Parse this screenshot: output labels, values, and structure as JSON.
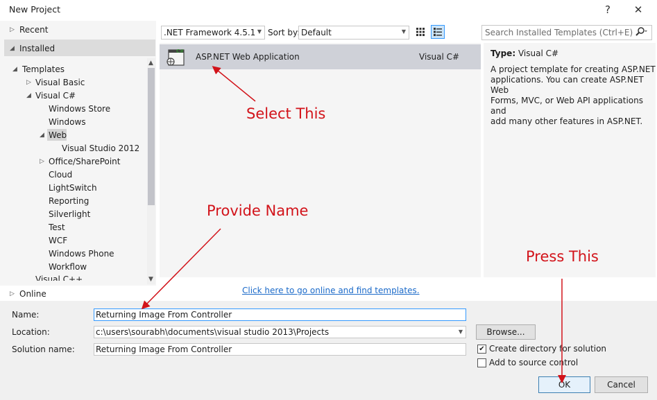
{
  "window": {
    "title": "New Project",
    "help": "?",
    "close": "✕"
  },
  "tree": {
    "recent": "Recent",
    "installed": "Installed",
    "templates": "Templates",
    "visual_basic": "Visual Basic",
    "visual_csharp": "Visual C#",
    "children": [
      "Windows Store",
      "Windows",
      "Web",
      "Visual Studio 2012",
      "Office/SharePoint",
      "Cloud",
      "LightSwitch",
      "Reporting",
      "Silverlight",
      "Test",
      "WCF",
      "Windows Phone",
      "Workflow"
    ],
    "cut_item": "Visual C++",
    "online": "Online"
  },
  "toolbar": {
    "framework": ".NET Framework 4.5.1",
    "sort_label": "Sort by:",
    "sort_value": "Default",
    "search_placeholder": "Search Installed Templates (Ctrl+E)"
  },
  "template": {
    "name": "ASP.NET Web Application",
    "language": "Visual C#",
    "badge": "C#"
  },
  "details": {
    "type_label": "Type:",
    "type_value": "Visual C#",
    "lines": [
      "A project template for creating ASP.NET",
      "applications. You can create ASP.NET Web",
      "Forms, MVC,  or Web API applications and",
      "add many other features in ASP.NET."
    ]
  },
  "online_link": "Click here to go online and find templates.",
  "form": {
    "name_label": "Name:",
    "name_value": "Returning Image From Controller",
    "location_label": "Location:",
    "location_value": "c:\\users\\sourabh\\documents\\visual studio 2013\\Projects",
    "solution_label": "Solution name:",
    "solution_value": "Returning Image From Controller",
    "browse": "Browse...",
    "create_dir": "Create directory for solution",
    "create_dir_checked": true,
    "source_control": "Add to source control",
    "source_control_checked": false,
    "ok": "OK",
    "cancel": "Cancel"
  },
  "annotations": {
    "select": "Select This",
    "provide": "Provide Name",
    "press": "Press This",
    "color": "#d2131a"
  }
}
